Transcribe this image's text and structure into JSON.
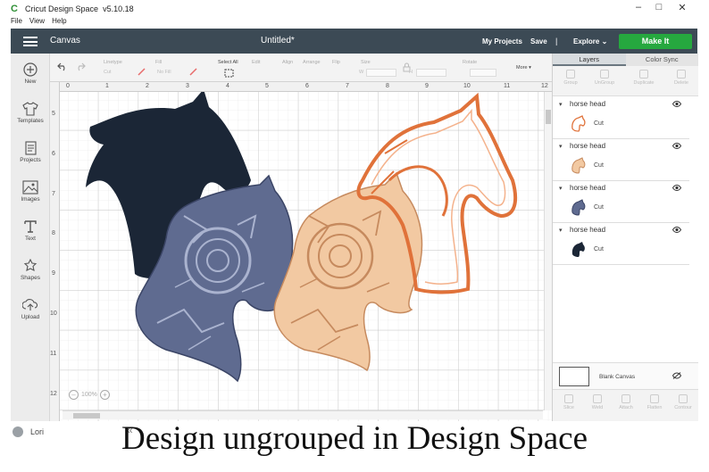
{
  "app": {
    "title": "Cricut Design Space",
    "version": "v5.10.18",
    "menu": [
      "File",
      "View",
      "Help"
    ],
    "window_controls": [
      "–",
      "□",
      "✕"
    ]
  },
  "header": {
    "section": "Canvas",
    "document_title": "Untitled*",
    "my_projects": "My Projects",
    "save": "Save",
    "separator": "|",
    "explore": "Explore",
    "make_it": "Make It",
    "colors": {
      "bar": "#3c4a55",
      "make_it": "#26a83f"
    }
  },
  "sidebar": {
    "items": [
      {
        "label": "New",
        "icon": "plus-circle-icon"
      },
      {
        "label": "Templates",
        "icon": "shirt-icon"
      },
      {
        "label": "Projects",
        "icon": "projects-icon"
      },
      {
        "label": "Images",
        "icon": "images-icon"
      },
      {
        "label": "Text",
        "icon": "text-icon"
      },
      {
        "label": "Shapes",
        "icon": "shapes-icon"
      },
      {
        "label": "Upload",
        "icon": "upload-icon"
      }
    ]
  },
  "toolbar": {
    "linetype_label": "Linetype",
    "linetype_value": "Cut",
    "fill_label": "Fill",
    "fill_value": "No Fill",
    "select_all": "Select All",
    "edit": "Edit",
    "align": "Align",
    "arrange": "Arrange",
    "flip": "Flip",
    "size": "Size",
    "size_w": "W",
    "size_h": "H",
    "rotate": "Rotate",
    "more": "More"
  },
  "canvas": {
    "ruler_top": [
      "0",
      "1",
      "2",
      "3",
      "4",
      "5",
      "6",
      "7",
      "8",
      "9",
      "10",
      "11",
      "12"
    ],
    "ruler_left": [
      "5",
      "6",
      "7",
      "8",
      "9",
      "10",
      "11",
      "12"
    ],
    "zoom_value": "100%",
    "zoom_minus": "–",
    "zoom_plus": "+"
  },
  "layers_panel": {
    "tabs": [
      "Layers",
      "Color Sync"
    ],
    "actions_top": [
      "Group",
      "UnGroup",
      "Duplicate",
      "Delete"
    ],
    "layers": [
      {
        "name": "horse head",
        "operation": "Cut",
        "color": "#e0723a"
      },
      {
        "name": "horse head",
        "operation": "Cut",
        "color": "#f2c9a2"
      },
      {
        "name": "horse head",
        "operation": "Cut",
        "color": "#5f6b90"
      },
      {
        "name": "horse head",
        "operation": "Cut",
        "color": "#1b2636"
      }
    ],
    "blank_canvas": "Blank Canvas",
    "actions_bottom": [
      "Slice",
      "Weld",
      "Attach",
      "Flatten",
      "Contour"
    ]
  },
  "footer": {
    "user": "Lori",
    "collapse": "«",
    "caption": "Design ungrouped in Design Space"
  }
}
